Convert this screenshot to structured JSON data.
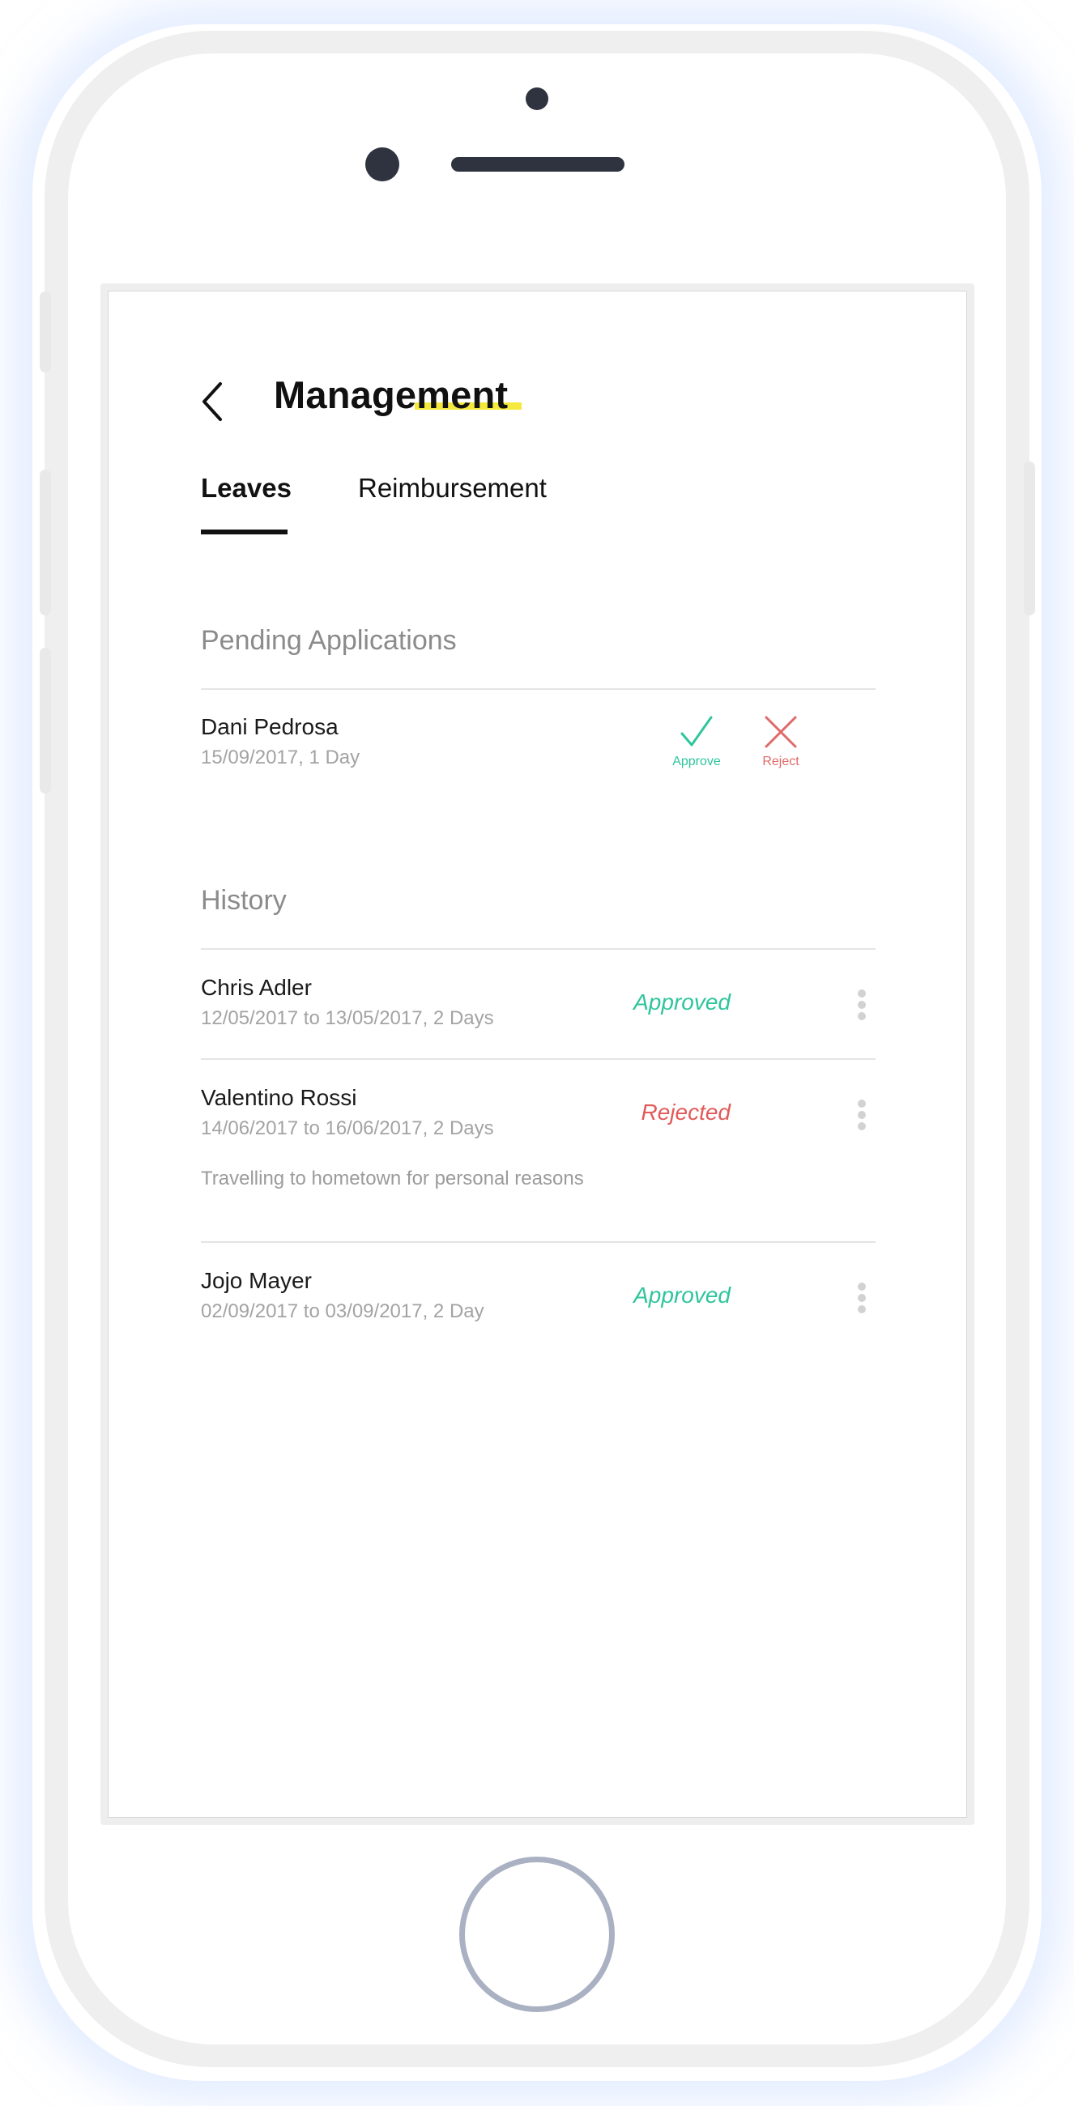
{
  "header": {
    "title": "Management"
  },
  "tabs": [
    {
      "label": "Leaves",
      "active": true
    },
    {
      "label": "Reimbursement",
      "active": false
    }
  ],
  "pending": {
    "section_title": "Pending Applications",
    "items": [
      {
        "name": "Dani Pedrosa",
        "meta": "15/09/2017, 1 Day",
        "approve_label": "Approve",
        "reject_label": "Reject"
      }
    ]
  },
  "history": {
    "section_title": "History",
    "items": [
      {
        "name": "Chris Adler",
        "meta": "12/05/2017 to 13/05/2017, 2 Days",
        "status": "Approved"
      },
      {
        "name": "Valentino Rossi",
        "meta": "14/06/2017 to 16/06/2017, 2 Days",
        "status": "Rejected",
        "note": "Travelling to hometown for personal reasons"
      },
      {
        "name": "Jojo Mayer",
        "meta": "02/09/2017 to 03/09/2017, 2 Day",
        "status": "Approved"
      }
    ]
  },
  "colors": {
    "approved": "#2fc59c",
    "rejected": "#e25a5a",
    "title_highlight": "#f4e93c",
    "device_accent": "#2f3340",
    "home_ring": "#aab1c3"
  },
  "icons": {
    "back": "chevron-left-icon",
    "approve": "check-icon",
    "reject": "close-icon",
    "more": "more-vertical-icon"
  }
}
